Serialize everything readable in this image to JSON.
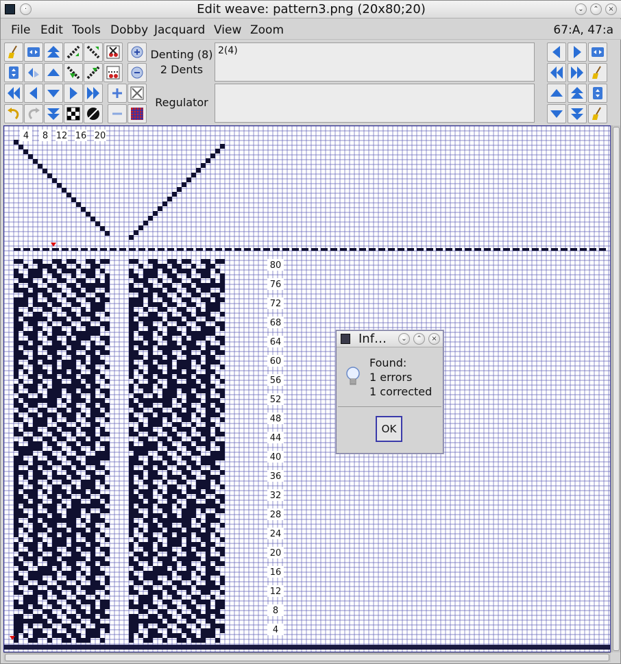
{
  "window": {
    "title": "Edit weave: pattern3.png (20x80;20)"
  },
  "menubar": {
    "items": [
      "File",
      "Edit",
      "Tools",
      "Dobby",
      "Jacquard",
      "View",
      "Zoom"
    ],
    "coords": "67:A,  47:a"
  },
  "toolbar": {
    "denting_label": "Denting (8)",
    "dents_label": "2 Dents",
    "denting_value": "2(4)",
    "regulator_label": "Regulator",
    "regulator_value": ""
  },
  "grid": {
    "column_numbers": [
      "4",
      "8",
      "12",
      "16",
      "20"
    ],
    "row_numbers": [
      "80",
      "76",
      "72",
      "68",
      "64",
      "60",
      "56",
      "52",
      "48",
      "44",
      "40",
      "36",
      "32",
      "28",
      "24",
      "20",
      "16",
      "12",
      "8",
      "4"
    ],
    "grid_line_color": "#2d2da0",
    "fill_color": "#101030",
    "cell_color": "#ffffff"
  },
  "dialog": {
    "title": "Inf…",
    "icon": "lightbulb-icon",
    "line1": "Found:",
    "line2": "1 errors",
    "line3": "1 corrected",
    "ok_label": "OK"
  }
}
